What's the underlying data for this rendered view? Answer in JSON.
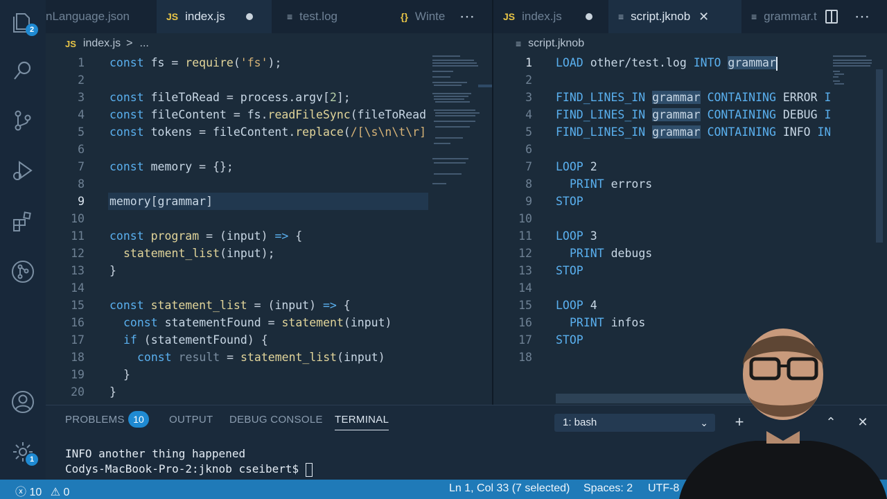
{
  "activity_bar": {
    "explorer_badge": "2",
    "manage_badge": "1"
  },
  "left_tabs": [
    {
      "label": "nLanguage.json",
      "icon": "json-braces"
    },
    {
      "label": "index.js",
      "icon": "JS",
      "modified": true
    },
    {
      "label": "test.log",
      "icon": "lines"
    },
    {
      "label": "Winte",
      "icon": "{}"
    }
  ],
  "left_icons": {
    "js": "JS",
    "braces": "{}",
    "lines": "≡"
  },
  "left_breadcrumb": {
    "file": "index.js",
    "sep": ">",
    "more": "..."
  },
  "left_code": [
    {
      "n": "1"
    },
    {
      "n": "2"
    },
    {
      "n": "3"
    },
    {
      "n": "4"
    },
    {
      "n": "5"
    },
    {
      "n": "6"
    },
    {
      "n": "7"
    },
    {
      "n": "8"
    },
    {
      "n": "9"
    },
    {
      "n": "10"
    },
    {
      "n": "11"
    },
    {
      "n": "12"
    },
    {
      "n": "13"
    },
    {
      "n": "14"
    },
    {
      "n": "15"
    },
    {
      "n": "16"
    },
    {
      "n": "17"
    },
    {
      "n": "18"
    },
    {
      "n": "19"
    },
    {
      "n": "20"
    }
  ],
  "right_tabs": [
    {
      "label": "index.js",
      "modified": true
    },
    {
      "label": "script.jknob",
      "active": true
    },
    {
      "label": "grammar.t"
    }
  ],
  "right_breadcrumb": {
    "file": "script.jknob"
  },
  "right_code": [
    {
      "n": "1"
    },
    {
      "n": "2"
    },
    {
      "n": "3"
    },
    {
      "n": "4"
    },
    {
      "n": "5"
    },
    {
      "n": "6"
    },
    {
      "n": "7"
    },
    {
      "n": "8"
    },
    {
      "n": "9"
    },
    {
      "n": "10"
    },
    {
      "n": "11"
    },
    {
      "n": "12"
    },
    {
      "n": "13"
    },
    {
      "n": "14"
    },
    {
      "n": "15"
    },
    {
      "n": "16"
    },
    {
      "n": "17"
    },
    {
      "n": "18"
    }
  ],
  "panel": {
    "tabs": [
      "PROBLEMS",
      "OUTPUT",
      "DEBUG CONSOLE",
      "TERMINAL"
    ],
    "problems_count": "10",
    "terminal_select": "1: bash",
    "terminal_lines": [
      "INFO another thing happened",
      "Codys-MacBook-Pro-2:jknob cseibert$ "
    ]
  },
  "status": {
    "errors": "10",
    "warnings": "0",
    "position": "Ln 1, Col 33 (7 selected)",
    "spaces": "Spaces: 2",
    "encoding": "UTF-8"
  },
  "colors": {
    "accent": "#1f8ad2",
    "status_bar": "#1f7ab8",
    "keyword": "#5ab0ef"
  }
}
